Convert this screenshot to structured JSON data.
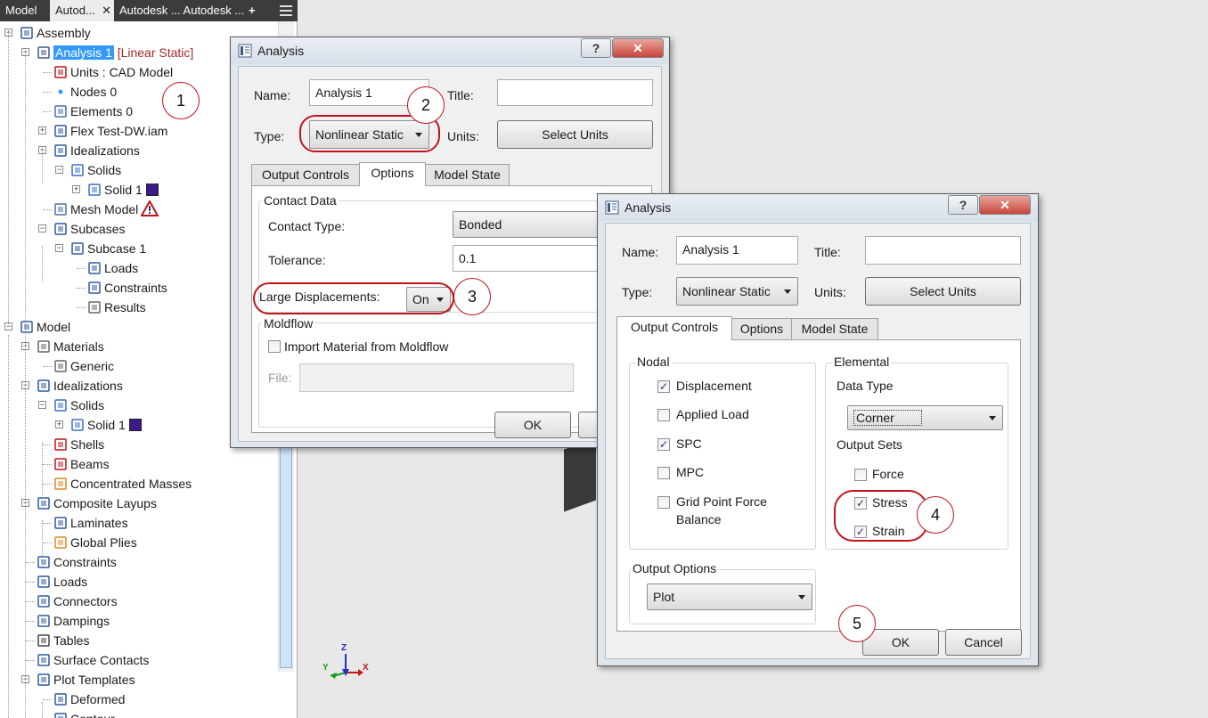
{
  "panel": {
    "tabs": [
      {
        "label": "Model",
        "active": false
      },
      {
        "label": "Autod...",
        "active": true,
        "close": "✕"
      },
      {
        "label": "Autodesk ... Autodesk ...",
        "active": false
      },
      {
        "label": "+",
        "active": false
      }
    ],
    "menu_icon": "hamburger-icon",
    "tree": [
      {
        "label": "Assembly",
        "icon": "assembly-icon",
        "level": 0,
        "expander": "−"
      },
      {
        "label": "Analysis 1",
        "suffix": "[Linear Static]",
        "icon": "analysis-icon",
        "level": 1,
        "expander": "−",
        "selected": true
      },
      {
        "label": "Units : CAD Model",
        "icon": "thermometer-icon",
        "level": 2
      },
      {
        "label": "Nodes 0",
        "icon": "node-dot-icon",
        "level": 2
      },
      {
        "label": "Elements 0",
        "icon": "element-icon",
        "level": 2
      },
      {
        "label": "Flex Test-DW.iam",
        "icon": "assembly-icon",
        "level": 2,
        "expander": "+"
      },
      {
        "label": "Idealizations",
        "icon": "idealization-icon",
        "level": 2,
        "expander": "−"
      },
      {
        "label": "Solids",
        "icon": "solids-icon",
        "level": 3,
        "expander": "−"
      },
      {
        "label": "Solid 1",
        "icon": "solid-icon",
        "level": 4,
        "expander": "+",
        "swatch": true
      },
      {
        "label": "Mesh Model",
        "icon": "mesh-icon",
        "level": 2,
        "warning": true
      },
      {
        "label": "Subcases",
        "icon": "subcases-icon",
        "level": 2,
        "expander": "−"
      },
      {
        "label": "Subcase 1",
        "icon": "subcase-icon",
        "level": 3,
        "expander": "−"
      },
      {
        "label": "Loads",
        "icon": "loads-icon",
        "level": 4
      },
      {
        "label": "Constraints",
        "icon": "constraints-icon",
        "level": 4
      },
      {
        "label": "Results",
        "icon": "results-icon",
        "level": 4
      },
      {
        "label": "Model",
        "icon": "model-icon",
        "level": 0,
        "expander": "−"
      },
      {
        "label": "Materials",
        "icon": "materials-icon",
        "level": 1,
        "expander": "−"
      },
      {
        "label": "Generic",
        "icon": "generic-icon",
        "level": 2
      },
      {
        "label": "Idealizations",
        "icon": "idealization-icon",
        "level": 1,
        "expander": "−"
      },
      {
        "label": "Solids",
        "icon": "solids-icon",
        "level": 2,
        "expander": "−"
      },
      {
        "label": "Solid 1",
        "icon": "solid-icon",
        "level": 3,
        "expander": "+",
        "swatch": true
      },
      {
        "label": "Shells",
        "icon": "shells-icon",
        "level": 2
      },
      {
        "label": "Beams",
        "icon": "beams-icon",
        "level": 2
      },
      {
        "label": "Concentrated Masses",
        "icon": "masses-icon",
        "level": 2
      },
      {
        "label": "Composite Layups",
        "icon": "composite-icon",
        "level": 1,
        "expander": "−"
      },
      {
        "label": "Laminates",
        "icon": "laminates-icon",
        "level": 2
      },
      {
        "label": "Global Plies",
        "icon": "plies-icon",
        "level": 2
      },
      {
        "label": "Constraints",
        "icon": "constraints-icon",
        "level": 1
      },
      {
        "label": "Loads",
        "icon": "loads-icon",
        "level": 1
      },
      {
        "label": "Connectors",
        "icon": "connectors-icon",
        "level": 1
      },
      {
        "label": "Dampings",
        "icon": "dampings-icon",
        "level": 1
      },
      {
        "label": "Tables",
        "icon": "tables-icon",
        "level": 1
      },
      {
        "label": "Surface Contacts",
        "icon": "surface-contacts-icon",
        "level": 1
      },
      {
        "label": "Plot Templates",
        "icon": "plot-templates-icon",
        "level": 1,
        "expander": "−"
      },
      {
        "label": "Deformed",
        "icon": "deformed-icon",
        "level": 2
      },
      {
        "label": "Contour",
        "icon": "contour-icon",
        "level": 2
      }
    ]
  },
  "triad": {
    "z": "Z",
    "y": "Y",
    "x": "X"
  },
  "dialog1": {
    "title": "Analysis",
    "help": "?",
    "close": "✕",
    "name_label": "Name:",
    "name_value": "Analysis 1",
    "title_label": "Title:",
    "title_value": "",
    "type_label": "Type:",
    "type_value": "Nonlinear Static",
    "units_label": "Units:",
    "select_units": "Select Units",
    "tabs": [
      "Output Controls",
      "Options",
      "Model State"
    ],
    "active_tab": "Options",
    "contact_group": "Contact Data",
    "contact_type_label": "Contact Type:",
    "contact_type_value": "Bonded",
    "tolerance_label": "Tolerance:",
    "tolerance_value": "0.1",
    "large_disp_label": "Large Displacements:",
    "large_disp_value": "On",
    "moldflow_group": "Moldflow",
    "import_label": "Import Material from Moldflow",
    "import_checked": false,
    "file_label": "File:",
    "file_value": "",
    "ok": "OK"
  },
  "dialog2": {
    "title": "Analysis",
    "help": "?",
    "close": "✕",
    "name_label": "Name:",
    "name_value": "Analysis 1",
    "title_label": "Title:",
    "title_value": "",
    "type_label": "Type:",
    "type_value": "Nonlinear Static",
    "units_label": "Units:",
    "select_units": "Select Units",
    "tabs": [
      "Output Controls",
      "Options",
      "Model State"
    ],
    "active_tab": "Output Controls",
    "nodal_group": "Nodal",
    "nodal": [
      {
        "label": "Displacement",
        "checked": true
      },
      {
        "label": "Applied Load",
        "checked": false
      },
      {
        "label": "SPC",
        "checked": true
      },
      {
        "label": "MPC",
        "checked": false
      },
      {
        "label": "Grid Point Force",
        "label2": "Balance",
        "checked": false
      }
    ],
    "elemental_group": "Elemental",
    "data_type_label": "Data Type",
    "data_type_value": "Corner",
    "output_sets_label": "Output Sets",
    "elemental": [
      {
        "label": "Force",
        "checked": false
      },
      {
        "label": "Stress",
        "checked": true
      },
      {
        "label": "Strain",
        "checked": true
      }
    ],
    "output_options_group": "Output Options",
    "output_options_value": "Plot",
    "ok": "OK",
    "cancel": "Cancel"
  },
  "callouts": [
    "1",
    "2",
    "3",
    "4",
    "5"
  ],
  "colors": {
    "accent": "#3399ff",
    "callout_red": "#c0141a",
    "swatch": "#3a1a8c"
  }
}
